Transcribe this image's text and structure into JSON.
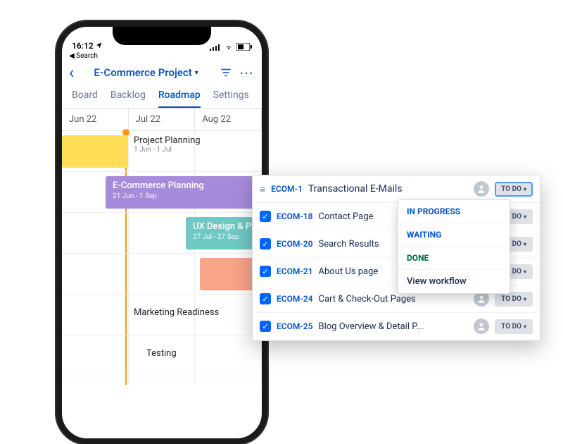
{
  "status_bar": {
    "time": "16:12",
    "back_label": "Search"
  },
  "nav": {
    "project_title": "E-Commerce Project"
  },
  "tabs": [
    "Board",
    "Backlog",
    "Roadmap",
    "Settings"
  ],
  "timeline_header": [
    "Jun 22",
    "Jul 22",
    "Aug 22"
  ],
  "epics": [
    {
      "title": "Project Planning",
      "dates": "1 Jun - 1 Jul"
    },
    {
      "title": "E-Commerce Planning",
      "dates": "21 Jun - 1 Sep"
    },
    {
      "title": "UX Design & Prototyping",
      "dates": "27 Jul - 27 Sep"
    },
    {
      "title": "",
      "dates": ""
    },
    {
      "title": "Marketing Readiness",
      "dates": ""
    },
    {
      "title": "Testing",
      "dates": ""
    }
  ],
  "panel": {
    "parent_key": "ECOM-1",
    "parent_title": "Transactional E-Mails",
    "parent_status": "TO DO",
    "children": [
      {
        "key": "ECOM-18",
        "title": "Contact Page",
        "status": "TO DO"
      },
      {
        "key": "ECOM-20",
        "title": "Search Results",
        "status": "TO DO"
      },
      {
        "key": "ECOM-21",
        "title": "About Us page",
        "status": "TO DO"
      },
      {
        "key": "ECOM-24",
        "title": "Cart & Check-Out Pages",
        "status": "TO DO"
      },
      {
        "key": "ECOM-25",
        "title": "Blog Overview & Detail P...",
        "status": "TO DO"
      }
    ]
  },
  "dropdown": {
    "options": [
      "IN PROGRESS",
      "WAITING",
      "DONE"
    ],
    "view_workflow": "View workflow"
  }
}
